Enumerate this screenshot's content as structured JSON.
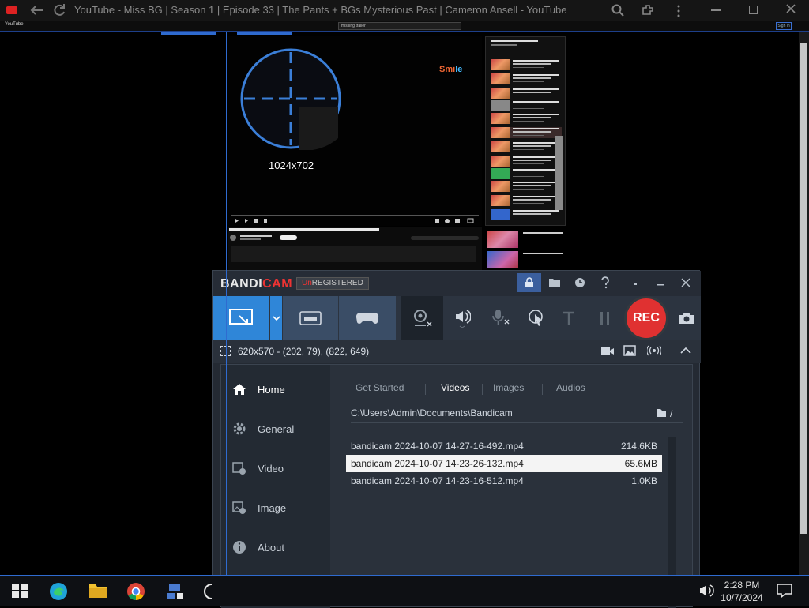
{
  "browser": {
    "window_title": "YouTube - Miss BG | Season 1 | Episode 33 | The Pants + BGs Mysterious Past | Cameron Ansell - YouTube",
    "tab_label": "YouTube",
    "search_value": "missing trailer",
    "signin_label": "Sign in"
  },
  "video": {
    "overlay_brand_a": "Smi",
    "overlay_brand_b": "le",
    "capture_resolution": "1024x702"
  },
  "bandicam": {
    "logo_a": "BANDI",
    "logo_b": "CAM",
    "unreg_a": "Un",
    "unreg_b": "REGISTERED",
    "rec_label": "REC",
    "area_text": "620x570 - (202, 79), (822, 649)",
    "nav": [
      {
        "label": "Home"
      },
      {
        "label": "General"
      },
      {
        "label": "Video"
      },
      {
        "label": "Image"
      },
      {
        "label": "About"
      }
    ],
    "tabs": [
      {
        "label": "Get Started"
      },
      {
        "label": "Videos"
      },
      {
        "label": "Images"
      },
      {
        "label": "Audios"
      }
    ],
    "path": "C:\\Users\\Admin\\Documents\\Bandicam",
    "path_suffix": "/",
    "files": [
      {
        "name": "bandicam 2024-10-07 14-27-16-492.mp4",
        "size": "214.6KB"
      },
      {
        "name": "bandicam 2024-10-07 14-23-26-132.mp4",
        "size": "65.6MB"
      },
      {
        "name": "bandicam 2024-10-07 14-23-16-512.mp4",
        "size": "1.0KB"
      }
    ]
  },
  "taskbar": {
    "time": "2:28 PM",
    "date": "10/7/2024"
  }
}
